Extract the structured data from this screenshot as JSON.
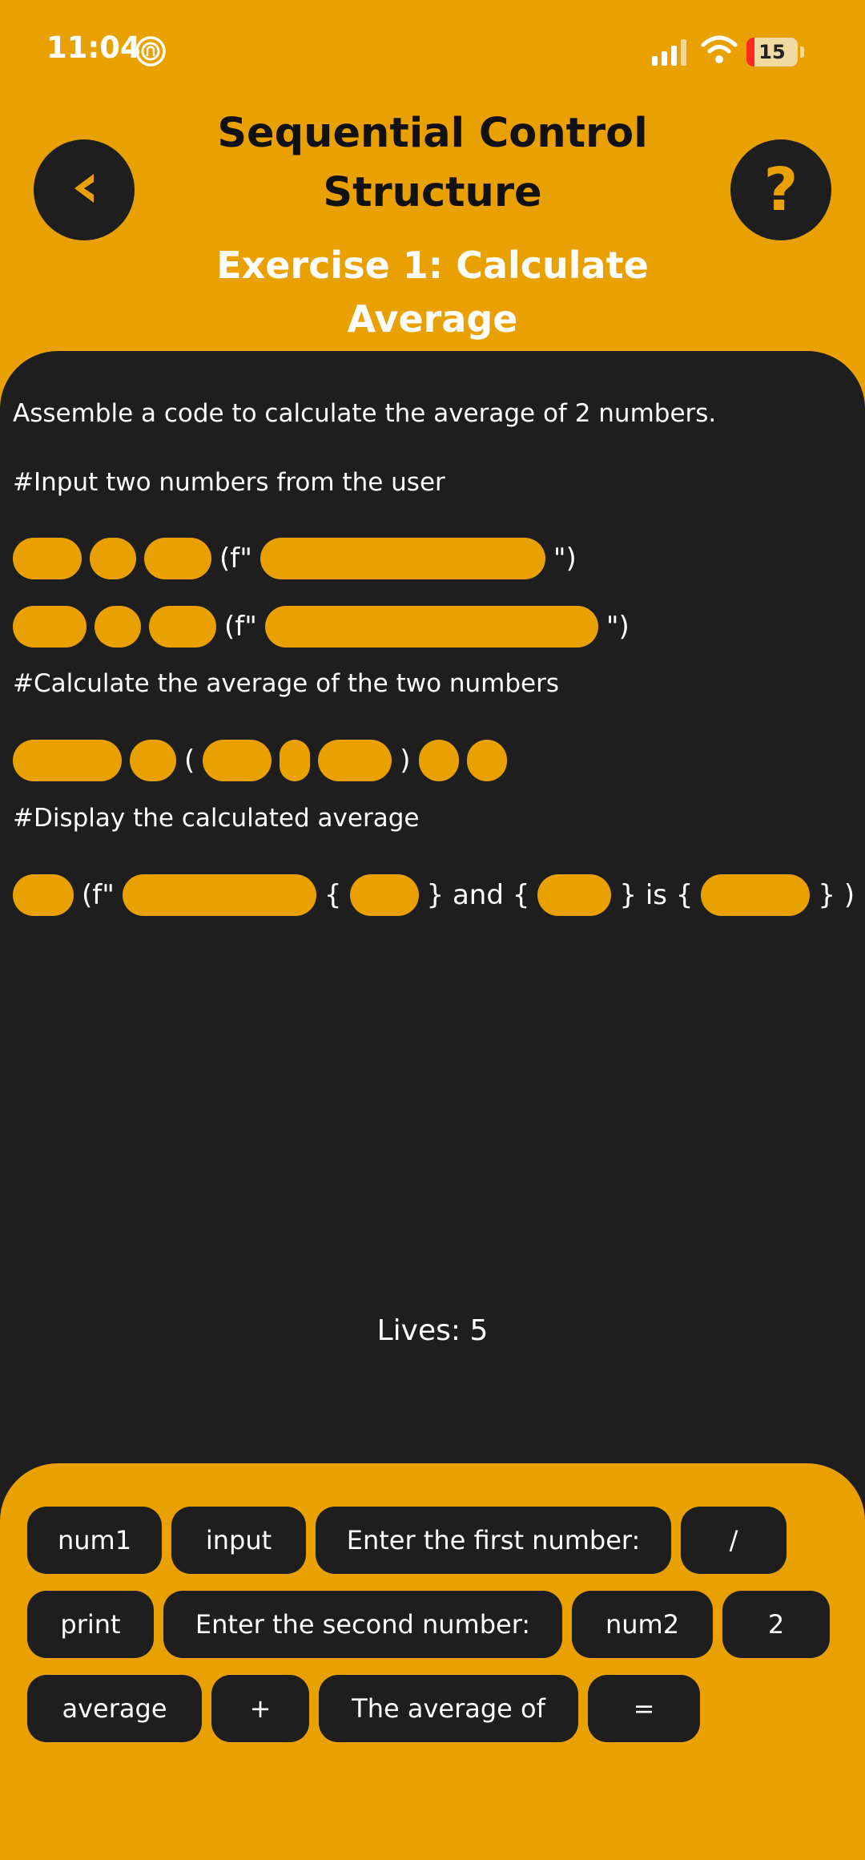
{
  "status": {
    "time": "11:04",
    "battery": "15",
    "battery_fraction": 0.15
  },
  "header": {
    "title": "Sequential Control Structure",
    "subtitle": "Exercise 1: Calculate Average",
    "back_icon": "chevron-left-icon",
    "help_label": "?"
  },
  "exercise": {
    "prompt": "Assemble a code to calculate the average of 2 numbers.",
    "comment_input": "#Input two numbers from the user",
    "comment_calc": "#Calculate the average of the two numbers",
    "comment_display": "#Display the calculated average",
    "tokens": {
      "fstring_open": "(f\"",
      "fstring_close": "\")",
      "paren_open": "(",
      "paren_close": ")",
      "brace_open": "{",
      "brace_close_and": "} and {",
      "brace_close_is": "} is {",
      "brace_close_end": "} )"
    }
  },
  "game": {
    "lives_label": "Lives: 5"
  },
  "word_bank": {
    "row1": [
      "num1",
      "input",
      "Enter the first number:",
      "/"
    ],
    "row2": [
      "print",
      "Enter the second number:",
      "num2",
      "2"
    ],
    "row3": [
      "average",
      "+",
      "The average of",
      "="
    ]
  },
  "colors": {
    "accent": "#E9A001",
    "panel": "#1E1E1E",
    "text_light": "#FFFFFF"
  }
}
